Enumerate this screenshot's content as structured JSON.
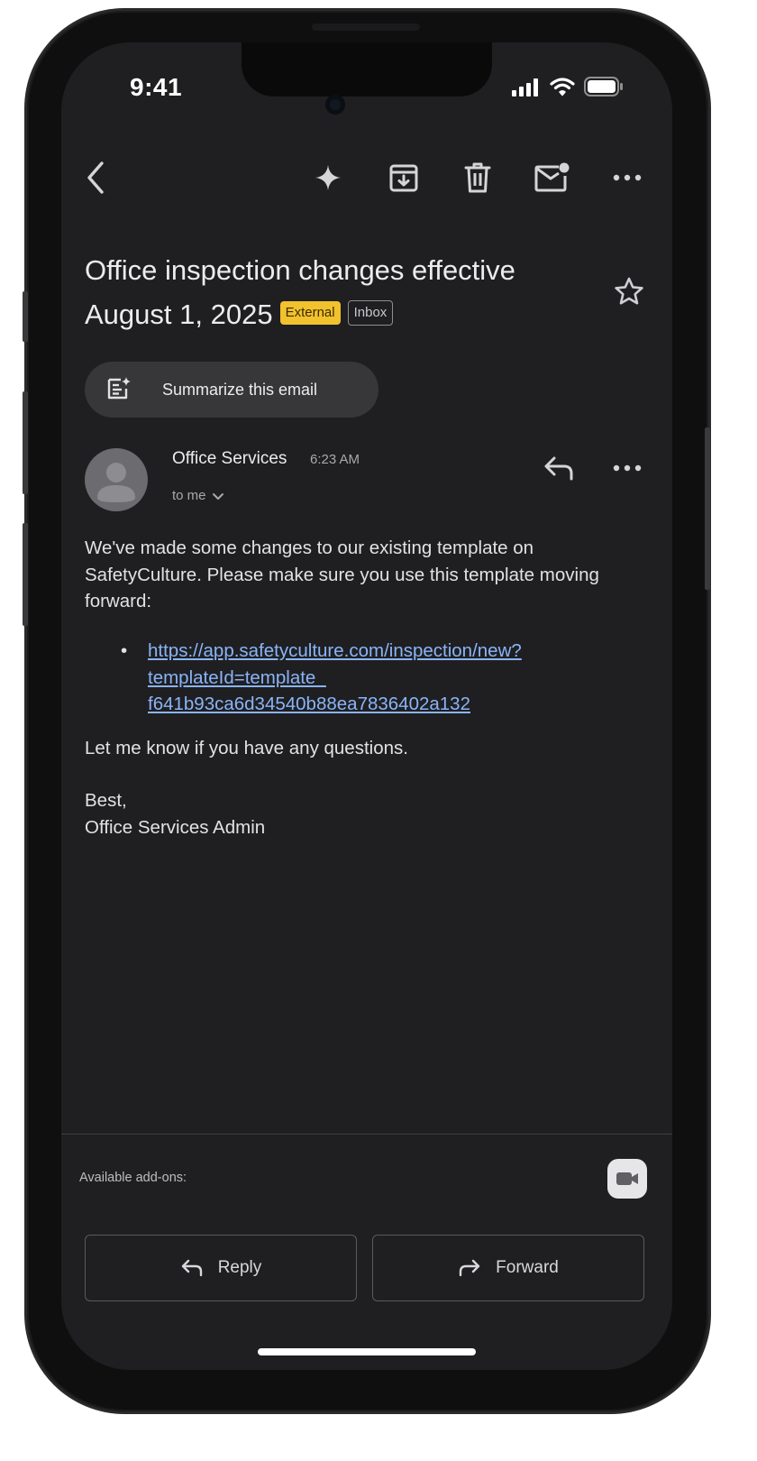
{
  "status_bar": {
    "time": "9:41"
  },
  "toolbar": {
    "back_icon": "chevron-left-icon",
    "icons": [
      "sparkle-icon",
      "archive-icon",
      "trash-icon",
      "mark-unread-icon",
      "more-icon"
    ]
  },
  "email": {
    "subject": "Office inspection changes effective August 1, 2025",
    "labels": {
      "external": "External",
      "inbox": "Inbox"
    },
    "summarize_label": "Summarize this email",
    "sender": "Office Services",
    "time": "6:23 AM",
    "recipient": "to me",
    "body": {
      "intro": "We've made some changes to our existing template on SafetyCulture. Please make sure you use this template moving forward:",
      "link_lines": [
        "https://app.safetyculture.com/inspection/new?",
        "templateId=template_",
        "f641b93ca6d34540b88ea7836402a132"
      ],
      "closing": "Let me know if you have any questions.",
      "signoff_1": "Best,",
      "signoff_2": "Office Services Admin"
    }
  },
  "footer": {
    "addons_label": "Available add-ons:",
    "reply_label": "Reply",
    "forward_label": "Forward"
  },
  "colors": {
    "background": "#1f1f21",
    "link": "#8ab4f8",
    "external_tag": "#f2c12e"
  }
}
